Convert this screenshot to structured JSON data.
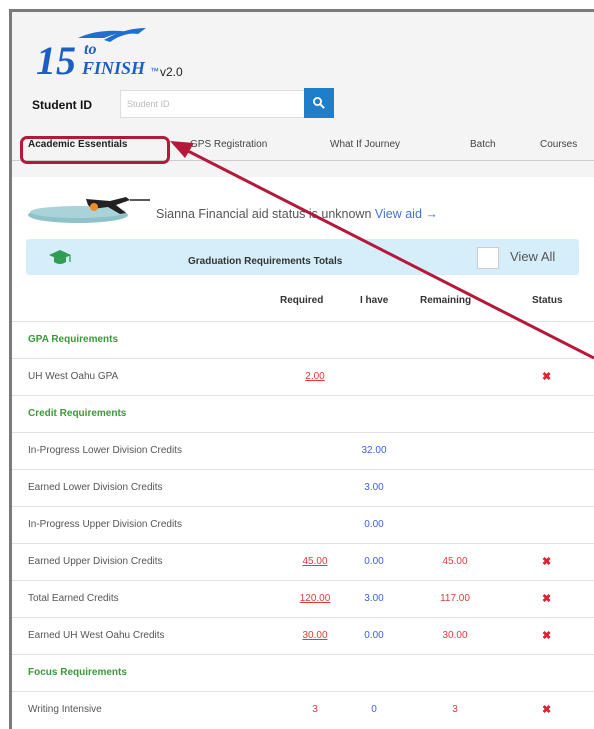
{
  "app": {
    "logo_number": "15",
    "logo_to": "to",
    "logo_finish": "FINISH",
    "logo_tm": "™",
    "version": "v2.0"
  },
  "student_id": {
    "label": "Student ID",
    "placeholder": "Student ID",
    "value": ""
  },
  "tabs": [
    {
      "label": "Academic Essentials",
      "active": true
    },
    {
      "label": "GPS Registration",
      "active": false
    },
    {
      "label": "What If Journey",
      "active": false
    },
    {
      "label": "Batch",
      "active": false
    },
    {
      "label": "Courses",
      "active": false
    }
  ],
  "financial": {
    "text": "Sianna Financial aid status is unknown",
    "link": "View aid →"
  },
  "graduation": {
    "title": "Graduation Requirements Totals",
    "view_all_label": "View All"
  },
  "columns": {
    "required": "Required",
    "have": "I have",
    "remaining": "Remaining",
    "status": "Status"
  },
  "rows": [
    {
      "type": "section",
      "label": "GPA Requirements"
    },
    {
      "type": "item",
      "label": "UH West Oahu GPA",
      "required": "2.00",
      "have": "",
      "remaining": "",
      "status": "✖"
    },
    {
      "type": "section",
      "label": "Credit Requirements"
    },
    {
      "type": "item",
      "label": "In-Progress Lower Division Credits",
      "required": "",
      "have": "32.00",
      "remaining": "",
      "status": ""
    },
    {
      "type": "item",
      "label": "Earned Lower Division Credits",
      "required": "",
      "have": "3.00",
      "remaining": "",
      "status": ""
    },
    {
      "type": "item",
      "label": "In-Progress Upper Division Credits",
      "required": "",
      "have": "0.00",
      "remaining": "",
      "status": ""
    },
    {
      "type": "item",
      "label": "Earned Upper Division Credits",
      "required": "45.00",
      "have": "0.00",
      "remaining": "45.00",
      "status": "✖"
    },
    {
      "type": "item",
      "label": "Total Earned Credits",
      "required": "120.00",
      "have": "3.00",
      "remaining": "117.00",
      "status": "✖"
    },
    {
      "type": "item",
      "label": "Earned UH West Oahu Credits",
      "required": "30.00",
      "have": "0.00",
      "remaining": "30.00",
      "status": "✖"
    },
    {
      "type": "section",
      "label": "Focus Requirements"
    },
    {
      "type": "item",
      "label": "Writing Intensive",
      "required": "3",
      "have": "0",
      "remaining": "3",
      "status": "✖"
    }
  ],
  "colors": {
    "accent_blue": "#1f7ec9",
    "section_green": "#3a9a3a",
    "required_red": "#e23a3a",
    "have_blue": "#3e5ee0",
    "highlight_red": "#b5193a",
    "banner_blue": "#d6eef9"
  },
  "icons": {
    "search": "search-icon",
    "graduation_cap": "graduation-cap-icon",
    "status_fail": "x-mark-icon",
    "plane": "plane-icon"
  }
}
